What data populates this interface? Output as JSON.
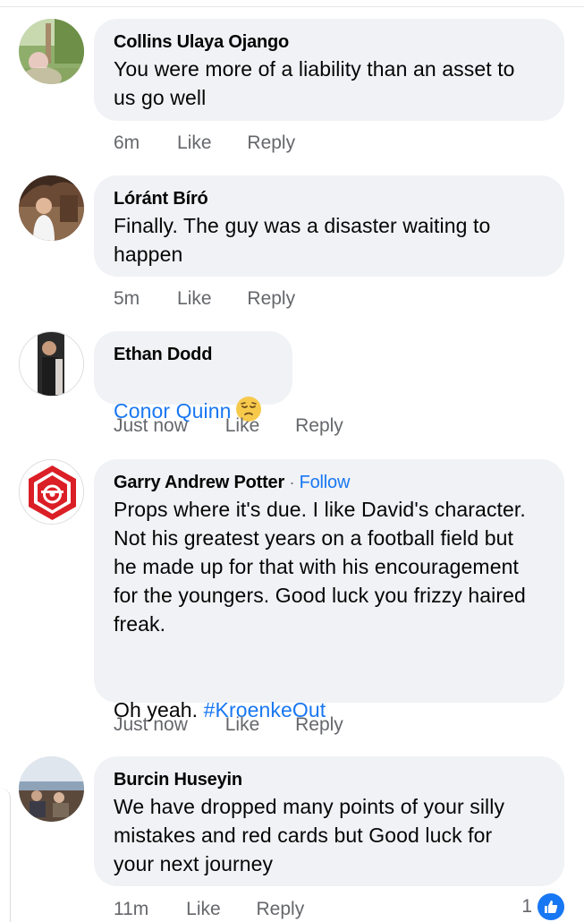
{
  "comments": [
    {
      "author": "Collins Ulaya Ojango",
      "text": "You were more of a liability than an asset to\nus go well",
      "time": "6m",
      "like": "Like",
      "reply": "Reply"
    },
    {
      "author": "Lóránt Bíró",
      "text": "Finally. The guy was a disaster waiting to\nhappen",
      "time": "5m",
      "like": "Like",
      "reply": "Reply"
    },
    {
      "author": "Ethan Dodd",
      "mention": "Conor Quinn",
      "emoji": "pensive-face",
      "time": "Just now",
      "like": "Like",
      "reply": "Reply"
    },
    {
      "author": "Garry Andrew Potter",
      "follow_sep": "·",
      "follow": "Follow",
      "text": "Props where it's due. I like David's character.\nNot his greatest years on a football field but\nhe made up for that with his encouragement\nfor the youngers. Good luck you frizzy haired\nfreak.",
      "text2": "Oh yeah. ",
      "hashtag": "#KroenkeOut",
      "time": "Just now",
      "like": "Like",
      "reply": "Reply"
    },
    {
      "author": "Burcin Huseyin",
      "text": "We have dropped many points of your silly\nmistakes and red cards but Good luck for\nyour next journey",
      "time": "11m",
      "like": "Like",
      "reply": "Reply",
      "reaction_count": "1",
      "reaction_icon": "thumbs-up-icon"
    }
  ],
  "colors": {
    "bubble": "#f0f2f5",
    "link": "#1877f2",
    "meta": "#65676b",
    "text": "#050505"
  }
}
